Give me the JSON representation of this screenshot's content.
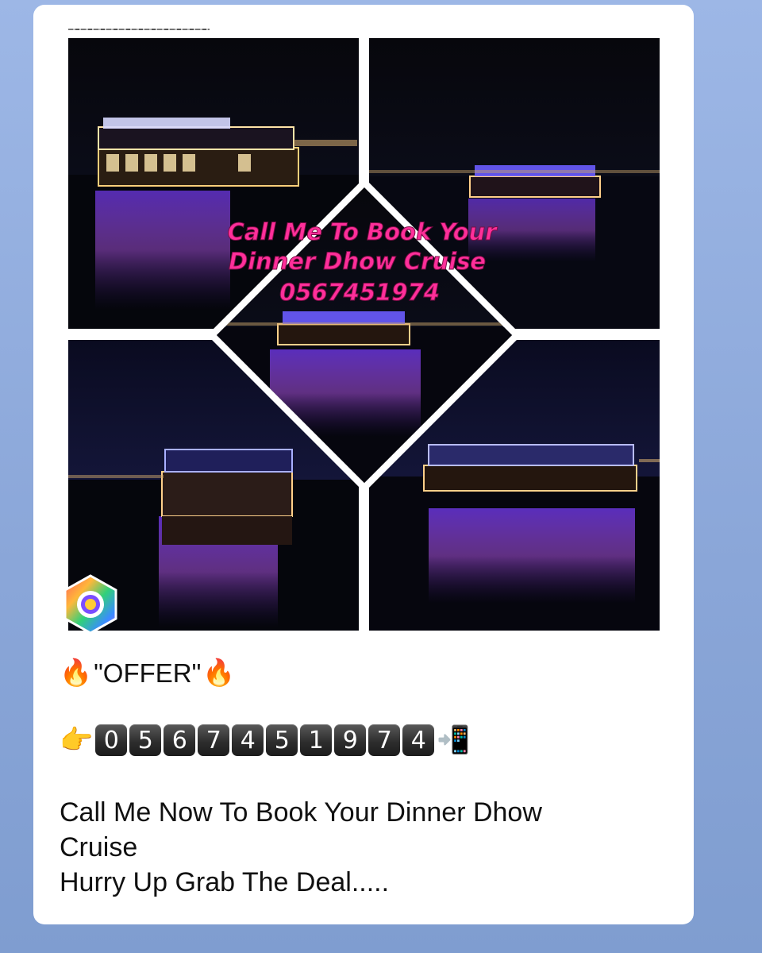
{
  "post": {
    "promo_image": {
      "overlay_lines": [
        "Call Me To Book Your",
        "Dinner Dhow Cruise",
        "0567451974"
      ]
    },
    "offer_label": "\"OFFER\"",
    "phone_digits": [
      "0",
      "5",
      "6",
      "7",
      "4",
      "5",
      "1",
      "9",
      "7",
      "4"
    ],
    "message_lines": [
      "Call Me Now To  Book Your Dinner Dhow",
      "Cruise",
      "Hurry Up Grab The Deal....."
    ]
  },
  "icons": [
    "fire-icon",
    "pointing-hand-icon",
    "mobile-phone-arrow-icon",
    "app-badge-icon"
  ],
  "colors": {
    "background": "#8aa6d8",
    "card": "#ffffff",
    "overlay_text": "#ff2f9a",
    "digit_key": "#2e2e2e"
  }
}
